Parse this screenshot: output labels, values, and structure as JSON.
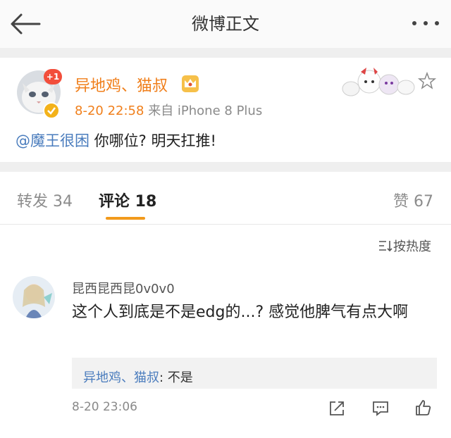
{
  "header": {
    "title": "微博正文",
    "back_icon": "back-arrow-icon",
    "more_icon": "more-dots-icon"
  },
  "post": {
    "badge": "+1",
    "username": "异地鸡、猫叔",
    "time": "8-20 22:58",
    "source": "来自 iPhone 8 Plus",
    "mention": "@魔王很困",
    "text": " 你哪位? 明天扛推!"
  },
  "tabs": {
    "repost": "转发 34",
    "comment": "评论 18",
    "like": "赞 67"
  },
  "sort": {
    "label": "按热度"
  },
  "comment": {
    "username": "昆西昆西昆0v0v0",
    "text": "这个人到底是不是edg的...? 感觉他脾气有点大啊",
    "reply_name": "异地鸡、猫叔",
    "reply_text": ": 不是",
    "time": "8-20 23:06"
  },
  "colors": {
    "accent": "#f07f1b",
    "link": "#4a7cbd",
    "tab_underline": "#f29a1c",
    "badge": "#f24e3b"
  }
}
